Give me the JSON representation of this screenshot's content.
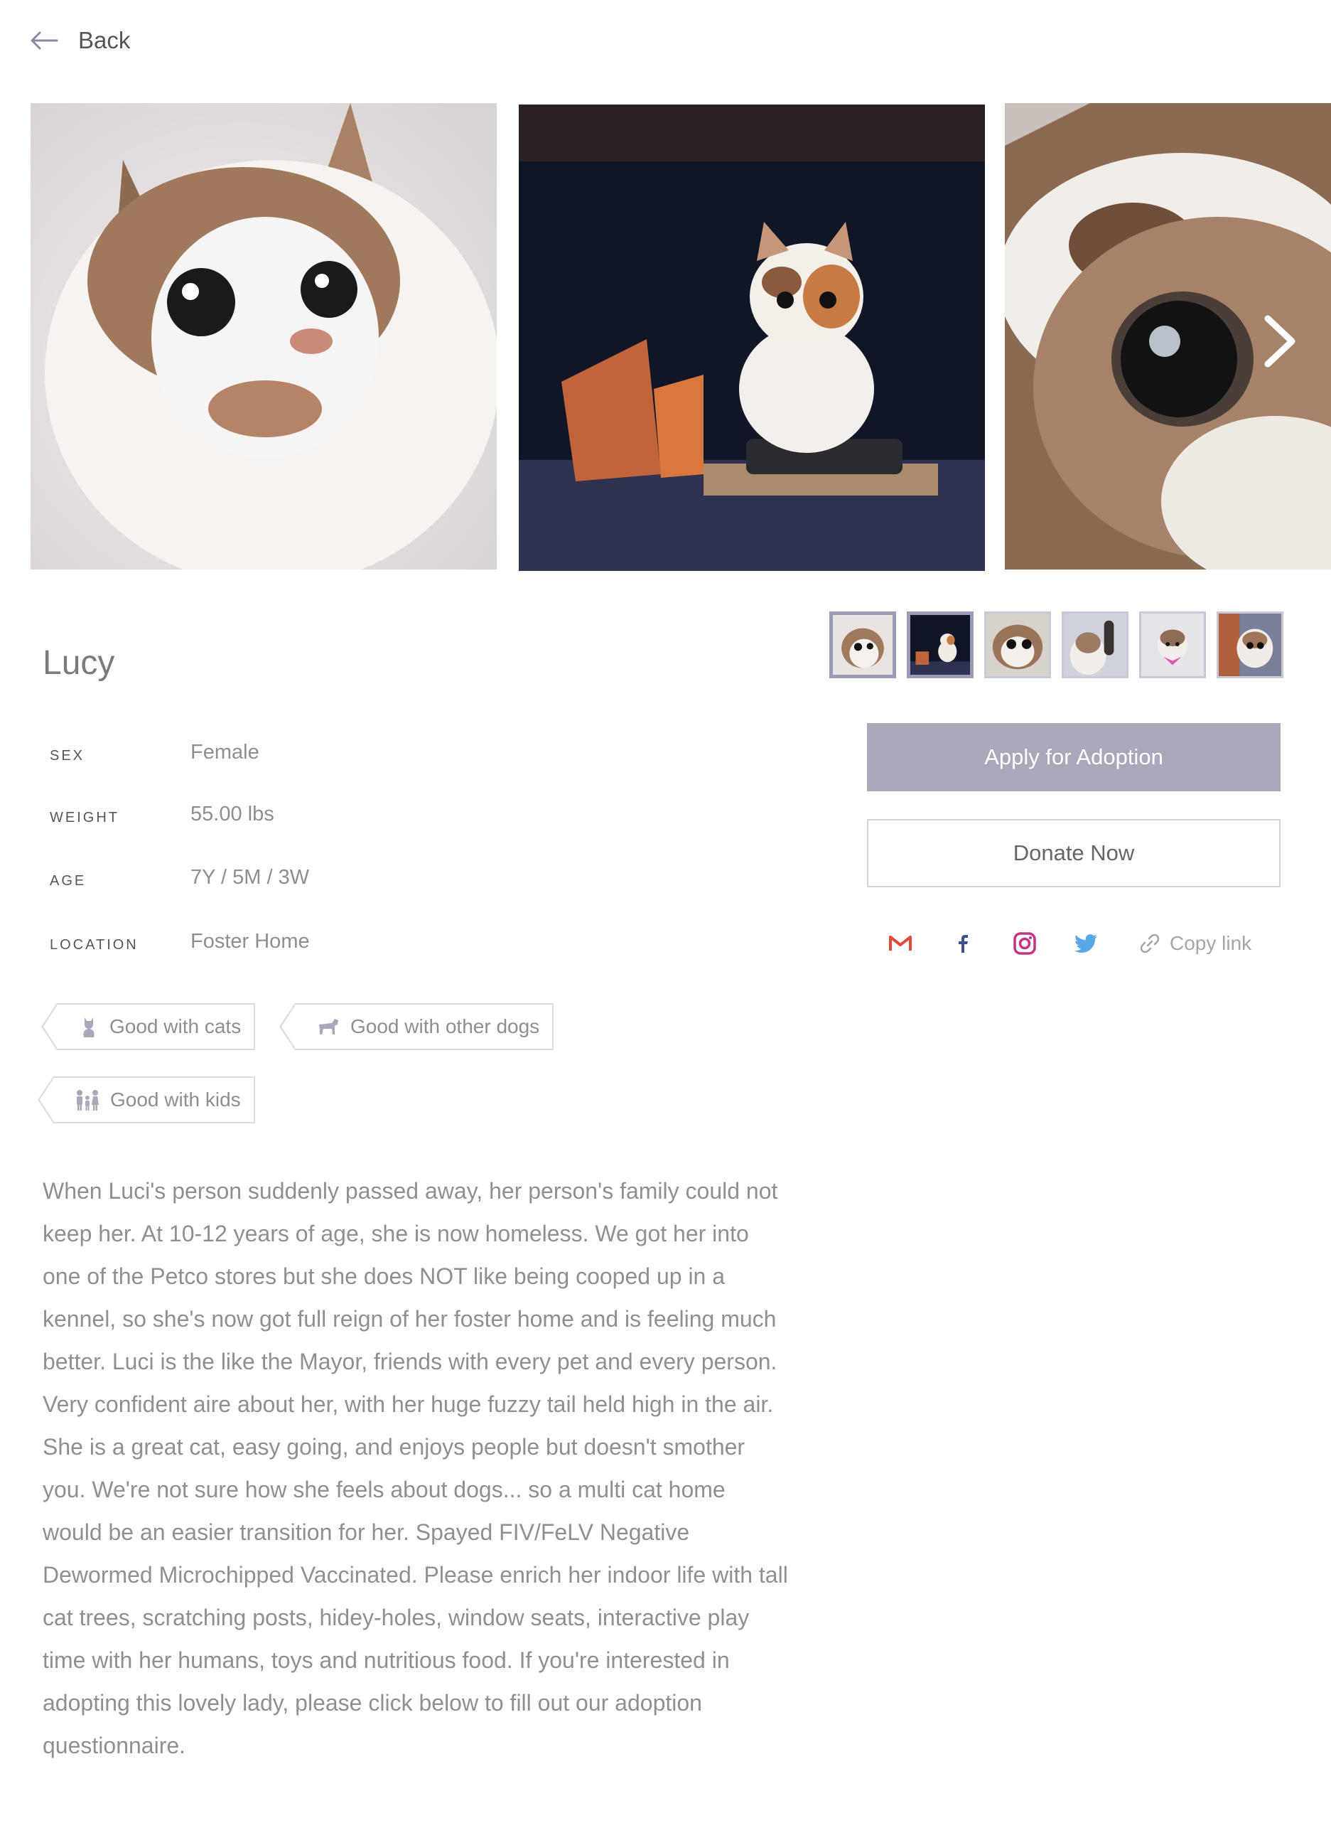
{
  "nav": {
    "back_label": "Back"
  },
  "pet": {
    "name": "Lucy",
    "facts": [
      {
        "label": "SEX",
        "value": "Female"
      },
      {
        "label": "WEIGHT",
        "value": "55.00 lbs"
      },
      {
        "label": "AGE",
        "value": "7Y / 5M / 3W"
      },
      {
        "label": "LOCATION",
        "value": "Foster Home"
      }
    ],
    "tags": [
      {
        "label": "Good with cats",
        "icon": "cat-icon"
      },
      {
        "label": "Good with other dogs",
        "icon": "dog-icon"
      },
      {
        "label": "Good with kids",
        "icon": "family-icon"
      }
    ],
    "description": "When Luci's person suddenly passed away, her person's family could not keep her. At 10-12 years of age, she is now homeless. We got her into one of the Petco stores but she does NOT like being cooped up in a kennel, so she's now got full reign of her foster home and is feeling much better. Luci is the like the Mayor, friends with every pet and every person. Very confident aire about her, with her huge fuzzy tail held high in the air. She is a great cat, easy going, and enjoys people but doesn't smother you. We're not sure how she feels about dogs... so a multi cat home would be an easier transition for her. Spayed FIV/FeLV Negative Dewormed Microchipped Vaccinated. Please enrich her indoor life with tall cat trees, scratching posts, hidey-holes, window seats, interactive play time with her humans, toys and nutritious food. If you're interested in adopting this lovely lady, please click below to fill out our adoption questionnaire."
  },
  "gallery": {
    "photo_count_visible": 3,
    "thumbnail_count": 6,
    "selected_thumbnail": 1,
    "next_icon": "chevron-right-icon"
  },
  "actions": {
    "apply_label": "Apply for Adoption",
    "donate_label": "Donate Now"
  },
  "share": {
    "icons": [
      "gmail-icon",
      "facebook-icon",
      "instagram-icon",
      "twitter-icon"
    ],
    "copy_label": "Copy link"
  },
  "colors": {
    "accent": "#a9a8bb",
    "gmail": "#e04a3a",
    "facebook": "#3b4f8c",
    "instagram": "#c13584",
    "twitter": "#5aa7e8"
  }
}
